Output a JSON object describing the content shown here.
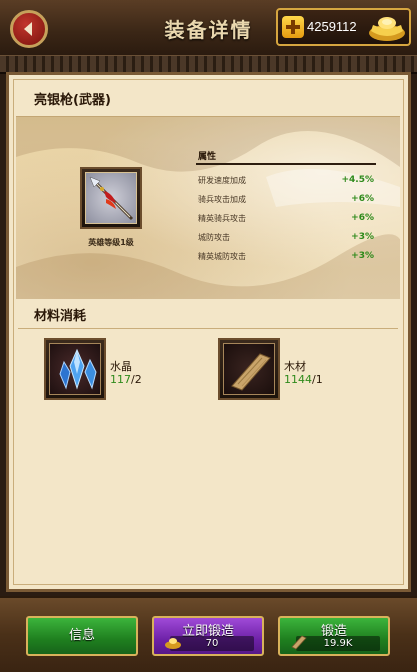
{
  "header": {
    "title": "装备详情",
    "gold_amount": "4259112"
  },
  "equipment": {
    "name": "亮银枪(武器)",
    "level_label": "英雄等级1级",
    "attributes_header": "属性",
    "attributes": [
      {
        "name": "研发速度加成",
        "value": "+4.5%"
      },
      {
        "name": "骑兵攻击加成",
        "value": "+6%"
      },
      {
        "name": "精英骑兵攻击",
        "value": "+6%"
      },
      {
        "name": "城防攻击",
        "value": "+3%"
      },
      {
        "name": "精英城防攻击",
        "value": "+3%"
      }
    ]
  },
  "materials": {
    "title": "材料消耗",
    "items": [
      {
        "name": "水晶",
        "have": "117",
        "need": "/2"
      },
      {
        "name": "木材",
        "have": "1144",
        "need": "/1"
      }
    ]
  },
  "buttons": {
    "info": "信息",
    "instant_forge": "立即锻造",
    "instant_cost": "70",
    "forge": "锻造",
    "forge_cost": "19.9K"
  },
  "colors": {
    "positive_value": "#2e8a1b",
    "gold_border": "#d6a640",
    "button_green": "#1f7f1f",
    "button_purple": "#6e22a8"
  }
}
